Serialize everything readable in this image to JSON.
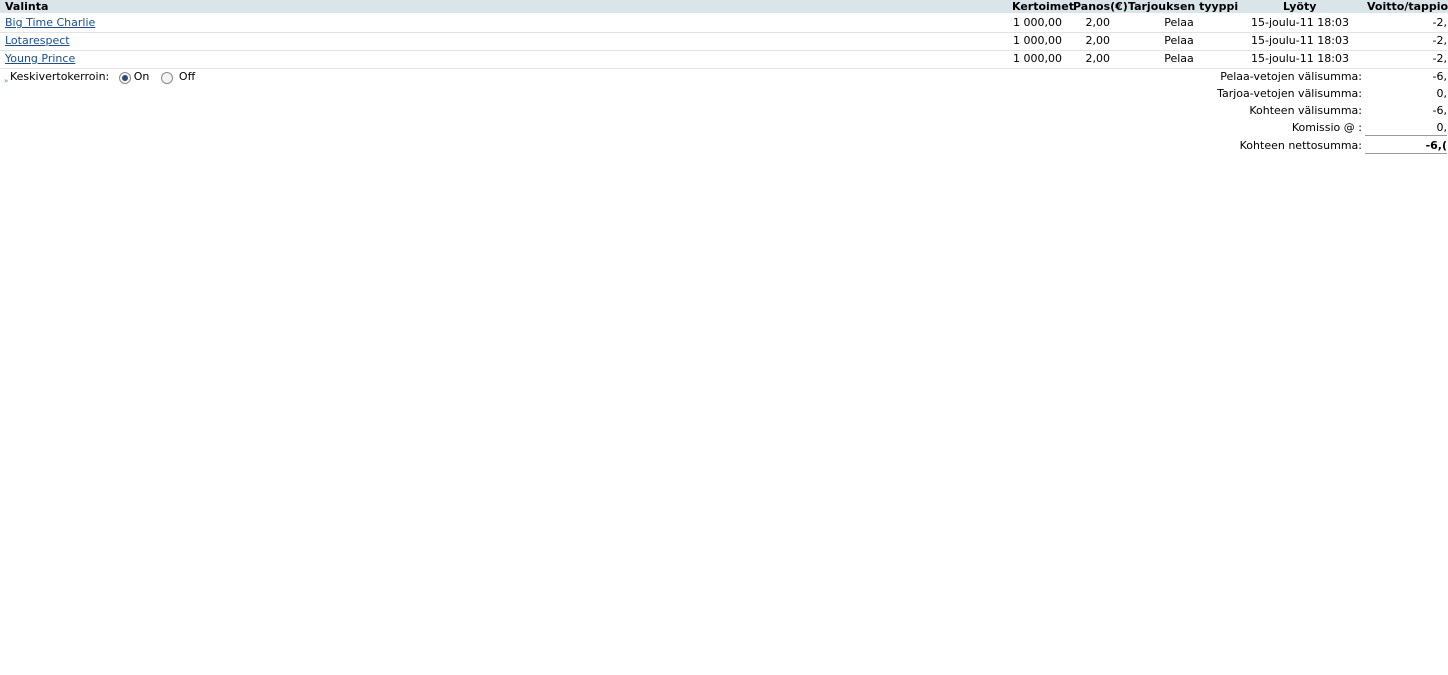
{
  "table": {
    "headers": {
      "selection": "Valinta",
      "odds": "Kertoimet",
      "stake": "Panos(€)",
      "bet_type": "Tarjouksen tyyppi",
      "placed": "Lyöty",
      "profit_loss": "Voitto/tappio("
    },
    "rows": [
      {
        "selection": "Big Time Charlie",
        "odds": "1 000,00",
        "stake": "2,00",
        "bet_type": "Pelaa",
        "placed": "15-joulu-11 18:03",
        "profit_loss": "-2,"
      },
      {
        "selection": "Lotarespect",
        "odds": "1 000,00",
        "stake": "2,00",
        "bet_type": "Pelaa",
        "placed": "15-joulu-11 18:03",
        "profit_loss": "-2,"
      },
      {
        "selection": "Young Prince",
        "odds": "1 000,00",
        "stake": "2,00",
        "bet_type": "Pelaa",
        "placed": "15-joulu-11 18:03",
        "profit_loss": "-2,"
      }
    ]
  },
  "average_odds": {
    "label": "Keskivertokerroin:",
    "help_icon": "help-icon",
    "options": [
      "On",
      "Off"
    ],
    "selected": "On"
  },
  "summary": {
    "back_subtotal_label": "Pelaa-vetojen välisumma:",
    "back_subtotal_value": "-6,",
    "lay_subtotal_label": "Tarjoa-vetojen välisumma:",
    "lay_subtotal_value": "0,",
    "market_subtotal_label": "Kohteen välisumma:",
    "market_subtotal_value": "-6,",
    "commission_label": "Komissio @ :",
    "commission_value": "0,",
    "market_net_label": "Kohteen nettosumma:",
    "market_net_value": "-6,("
  },
  "colors": {
    "header_bg": "#dae5ea",
    "link": "#1a4f8a",
    "row_divider": "#e3e3e3"
  }
}
